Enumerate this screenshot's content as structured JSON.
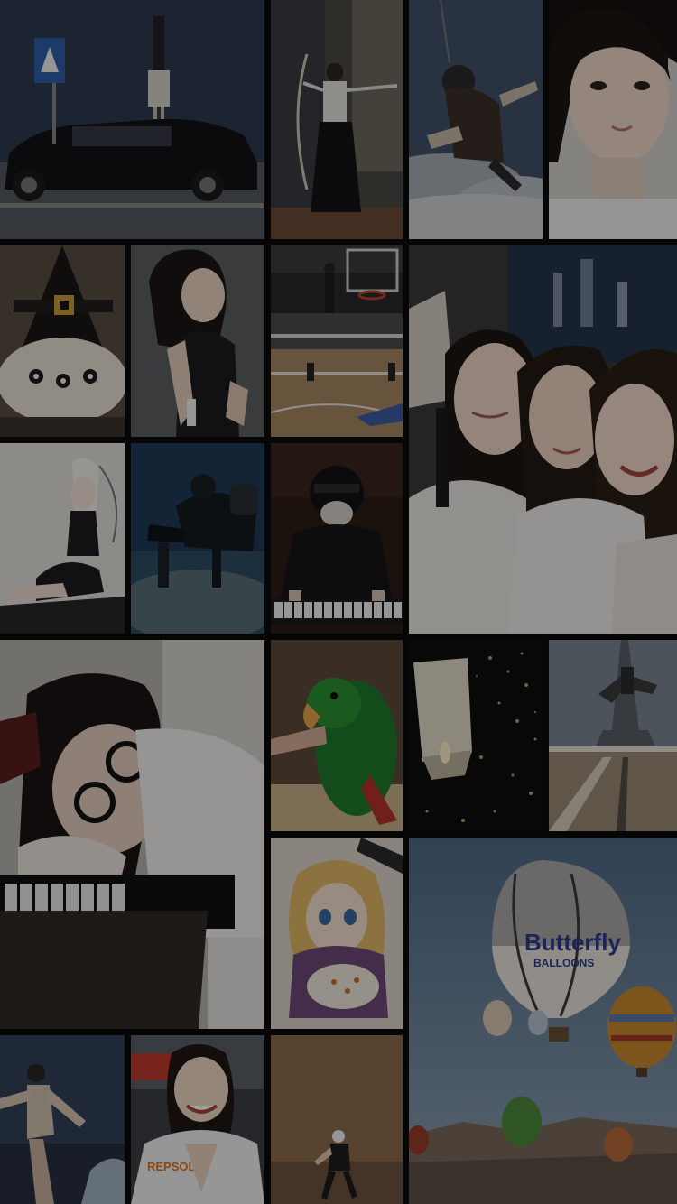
{
  "gallery": {
    "tiles": [
      {
        "id": "handstand-on-car",
        "subject": "person doing handstand on black car roof"
      },
      {
        "id": "archer-in-kimono",
        "subject": "archer in traditional dress"
      },
      {
        "id": "tandem-skydivers",
        "subject": "tandem skydivers above clouds"
      },
      {
        "id": "portrait-short-hair",
        "subject": "portrait of woman with short hair"
      },
      {
        "id": "witch-hat-cake",
        "subject": "witch hat shaped cake"
      },
      {
        "id": "woman-black-dress",
        "subject": "woman in black dress"
      },
      {
        "id": "basketball-dunk",
        "subject": "basketball dunk in gym"
      },
      {
        "id": "three-friends-selfie",
        "subject": "three friends selfie"
      },
      {
        "id": "anime-figure",
        "subject": "anime figurine"
      },
      {
        "id": "scuba-divers",
        "subject": "scuba divers underwater"
      },
      {
        "id": "masked-pianist",
        "subject": "masked keyboard player"
      },
      {
        "id": "girl-on-piano",
        "subject": "girl with glasses resting on piano"
      },
      {
        "id": "green-parrot",
        "subject": "green parrot"
      },
      {
        "id": "sky-lantern",
        "subject": "sky lantern at night"
      },
      {
        "id": "eiffel-tower-jump",
        "subject": "person jumping near Eiffel tower"
      },
      {
        "id": "anime-drawing",
        "subject": "anime drawing on paper"
      },
      {
        "id": "hot-air-balloons",
        "subject": "hot air balloons over valley",
        "balloon_brand": "Butterfly",
        "balloon_sub": "BALLOONS"
      },
      {
        "id": "sunset-dancer",
        "subject": "dancer at sunset"
      },
      {
        "id": "racing-girl",
        "subject": "smiling woman in racing jacket",
        "jacket_text": "REPSOL"
      },
      {
        "id": "street-dancer",
        "subject": "street dancer in room"
      }
    ]
  }
}
